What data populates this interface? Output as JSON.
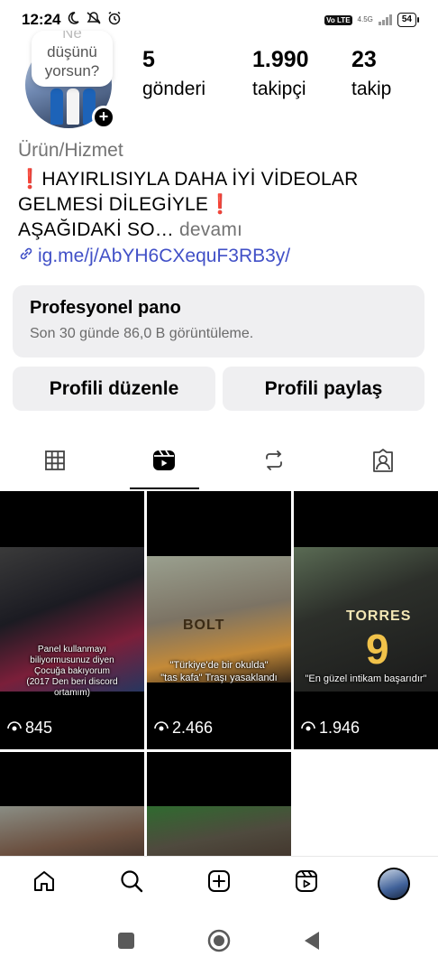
{
  "status_bar": {
    "time": "12:24",
    "volte": "Vo LTE",
    "network": "4.5G",
    "battery": "54"
  },
  "profile": {
    "note": {
      "line1": "Ne",
      "line2": "düşünü",
      "line3": "yorsun?"
    },
    "stats": [
      {
        "value": "5",
        "label": "gönderi"
      },
      {
        "value": "1.990",
        "label": "takipçi"
      },
      {
        "value": "23",
        "label": "takip"
      }
    ],
    "category": "Ürün/Hizmet",
    "bio": {
      "mark": "❗",
      "line1": "HAYIRLISIYLA DAHA İYİ VİDEOLAR",
      "line2": "GELMESİ DİLEGİYLE",
      "line3": "AŞAĞIDAKİ SO…",
      "more": "devamı"
    },
    "link": "ig.me/j/AbYH6CXequF3RB3y/"
  },
  "professional_dashboard": {
    "title": "Profesyonel pano",
    "subtitle": "Son 30 günde 86,0 B görüntüleme."
  },
  "buttons": {
    "edit": "Profili düzenle",
    "share": "Profili paylaş"
  },
  "tabs": [
    {
      "icon": "grid-icon",
      "active": false
    },
    {
      "icon": "reels-icon",
      "active": true
    },
    {
      "icon": "repost-icon",
      "active": false
    },
    {
      "icon": "tagged-icon",
      "active": false
    }
  ],
  "reels": [
    {
      "overlay": "Panel kullanmayı\nbiliyormusunuz diyen\nÇocuğa bakıyorum\n(2017 Den beri discord\nortamım)",
      "views": "845"
    },
    {
      "overlay": "\"Türkiye'de bir okulda\"\n\"tas kafa\" Traşı yasaklandı",
      "jersey": "BOLT",
      "views": "2.466"
    },
    {
      "overlay": "\"En güzel intikam başarıdır\"",
      "jersey": "TORRES",
      "jersey_number": "9",
      "views": "1.946"
    },
    {
      "overlay": "",
      "views": ""
    },
    {
      "overlay": "",
      "views": ""
    }
  ],
  "bottom_nav": [
    "home-icon",
    "search-icon",
    "create-icon",
    "reels-icon",
    "profile-avatar"
  ],
  "system_nav": [
    "recents-icon",
    "home-circle-icon",
    "back-icon"
  ]
}
